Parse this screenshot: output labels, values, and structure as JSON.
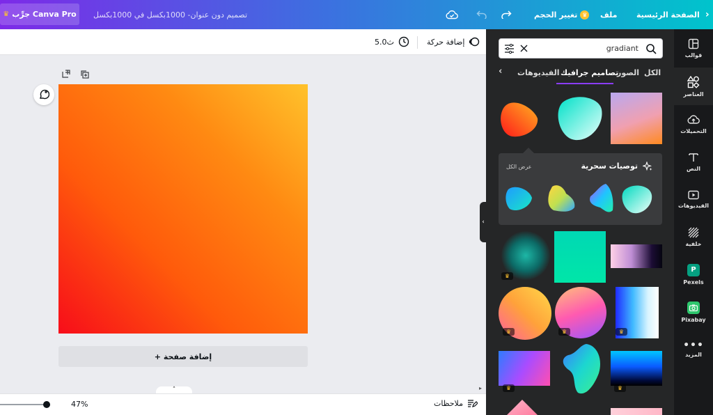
{
  "topbar": {
    "try_pro": "جرِّب Canva Pro",
    "doc_title": "تصميم دون عنوان- 1000بكسل في 1000بكسل",
    "resize": "تغيير الحجم",
    "file": "ملف",
    "home": "الصفحة الرئيسية"
  },
  "toolbar": {
    "duration": "5.0ث",
    "animate": "إضافة حركة"
  },
  "sidebar": {
    "items": [
      {
        "label": "قوالب",
        "icon": "layout-icon"
      },
      {
        "label": "العناصر",
        "icon": "shapes-icon"
      },
      {
        "label": "التحميلات",
        "icon": "cloud-upload-icon"
      },
      {
        "label": "النص",
        "icon": "text-icon"
      },
      {
        "label": "الفيديوهات",
        "icon": "video-icon"
      },
      {
        "label": "خلفية",
        "icon": "pattern-icon"
      },
      {
        "label": "Pexels",
        "icon": "pexels-icon"
      },
      {
        "label": "Pixabay",
        "icon": "pixabay-icon"
      },
      {
        "label": "المزيد",
        "icon": "more-icon"
      }
    ]
  },
  "panel": {
    "search_value": "gradiant",
    "tabs": [
      "الكل",
      "الصور",
      "تصاميم جرافيك",
      "الفيديوهات"
    ],
    "magic_title": "توصيات سحرية",
    "see_all": "عرض الكل"
  },
  "canvas": {
    "add_page": "+ إضافة صفحة"
  },
  "footer": {
    "notes": "ملاحظات",
    "zoom": "47%"
  },
  "colors": {
    "brand_purple": "#7d2ae8",
    "brand_teal": "#00c4cc",
    "panel_bg": "#252627",
    "sidebar_bg": "#18191b",
    "accent": "#8b3dff"
  }
}
